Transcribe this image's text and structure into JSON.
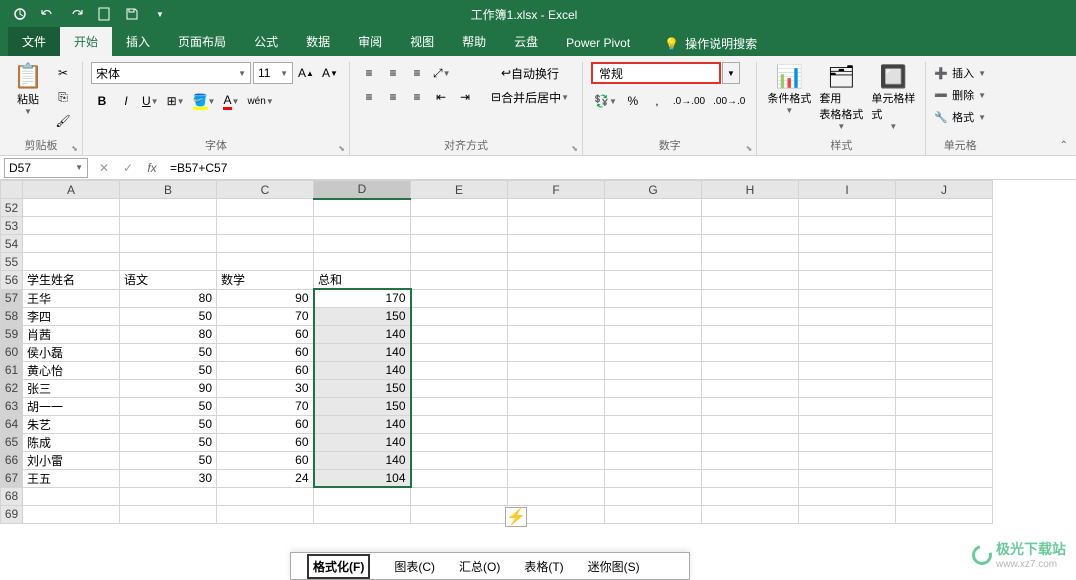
{
  "title": "工作簿1.xlsx  -  Excel",
  "tabs": {
    "file": "文件",
    "home": "开始",
    "insert": "插入",
    "pagelayout": "页面布局",
    "formulas": "公式",
    "data": "数据",
    "review": "审阅",
    "view": "视图",
    "help": "帮助",
    "cloud": "云盘",
    "powerpivot": "Power Pivot",
    "tellme": "操作说明搜索"
  },
  "ribbon": {
    "clipboard": {
      "label": "剪贴板",
      "paste": "粘贴"
    },
    "font": {
      "label": "字体",
      "name": "宋体",
      "size": "11"
    },
    "alignment": {
      "label": "对齐方式",
      "wrap": "自动换行",
      "merge": "合并后居中"
    },
    "number": {
      "label": "数字",
      "format": "常规"
    },
    "styles": {
      "label": "样式",
      "cond": "条件格式",
      "table": "套用\n表格格式",
      "cell": "单元格样式"
    },
    "cells": {
      "label": "单元格",
      "insert": "插入",
      "delete": "删除",
      "format": "格式"
    }
  },
  "namebox": "D57",
  "formula": "=B57+C57",
  "columns": [
    "A",
    "B",
    "C",
    "D",
    "E",
    "F",
    "G",
    "H",
    "I",
    "J"
  ],
  "rows": [
    52,
    53,
    54,
    55,
    56,
    57,
    58,
    59,
    60,
    61,
    62,
    63,
    64,
    65,
    66,
    67,
    68,
    69
  ],
  "grid": {
    "56": {
      "A": "学生姓名",
      "B": "语文",
      "C": "数学",
      "D": "总和"
    },
    "57": {
      "A": "王华",
      "B": "80",
      "C": "90",
      "D": "170"
    },
    "58": {
      "A": "李四",
      "B": "50",
      "C": "70",
      "D": "150"
    },
    "59": {
      "A": "肖茜",
      "B": "80",
      "C": "60",
      "D": "140"
    },
    "60": {
      "A": "侯小磊",
      "B": "50",
      "C": "60",
      "D": "140"
    },
    "61": {
      "A": "黄心怡",
      "B": "50",
      "C": "60",
      "D": "140"
    },
    "62": {
      "A": "张三",
      "B": "90",
      "C": "30",
      "D": "150"
    },
    "63": {
      "A": "胡一一",
      "B": "50",
      "C": "70",
      "D": "150"
    },
    "64": {
      "A": "朱艺",
      "B": "50",
      "C": "60",
      "D": "140"
    },
    "65": {
      "A": "陈成",
      "B": "50",
      "C": "60",
      "D": "140"
    },
    "66": {
      "A": "刘小雷",
      "B": "50",
      "C": "60",
      "D": "140"
    },
    "67": {
      "A": "王五",
      "B": "30",
      "C": "24",
      "D": "104"
    }
  },
  "bottomMenu": {
    "format": "格式化(F)",
    "chart": "图表(C)",
    "totals": "汇总(O)",
    "tables": "表格(T)",
    "sparklines": "迷你图(S)"
  },
  "watermark": {
    "text": "极光下载站",
    "url": "www.xz7.com"
  }
}
